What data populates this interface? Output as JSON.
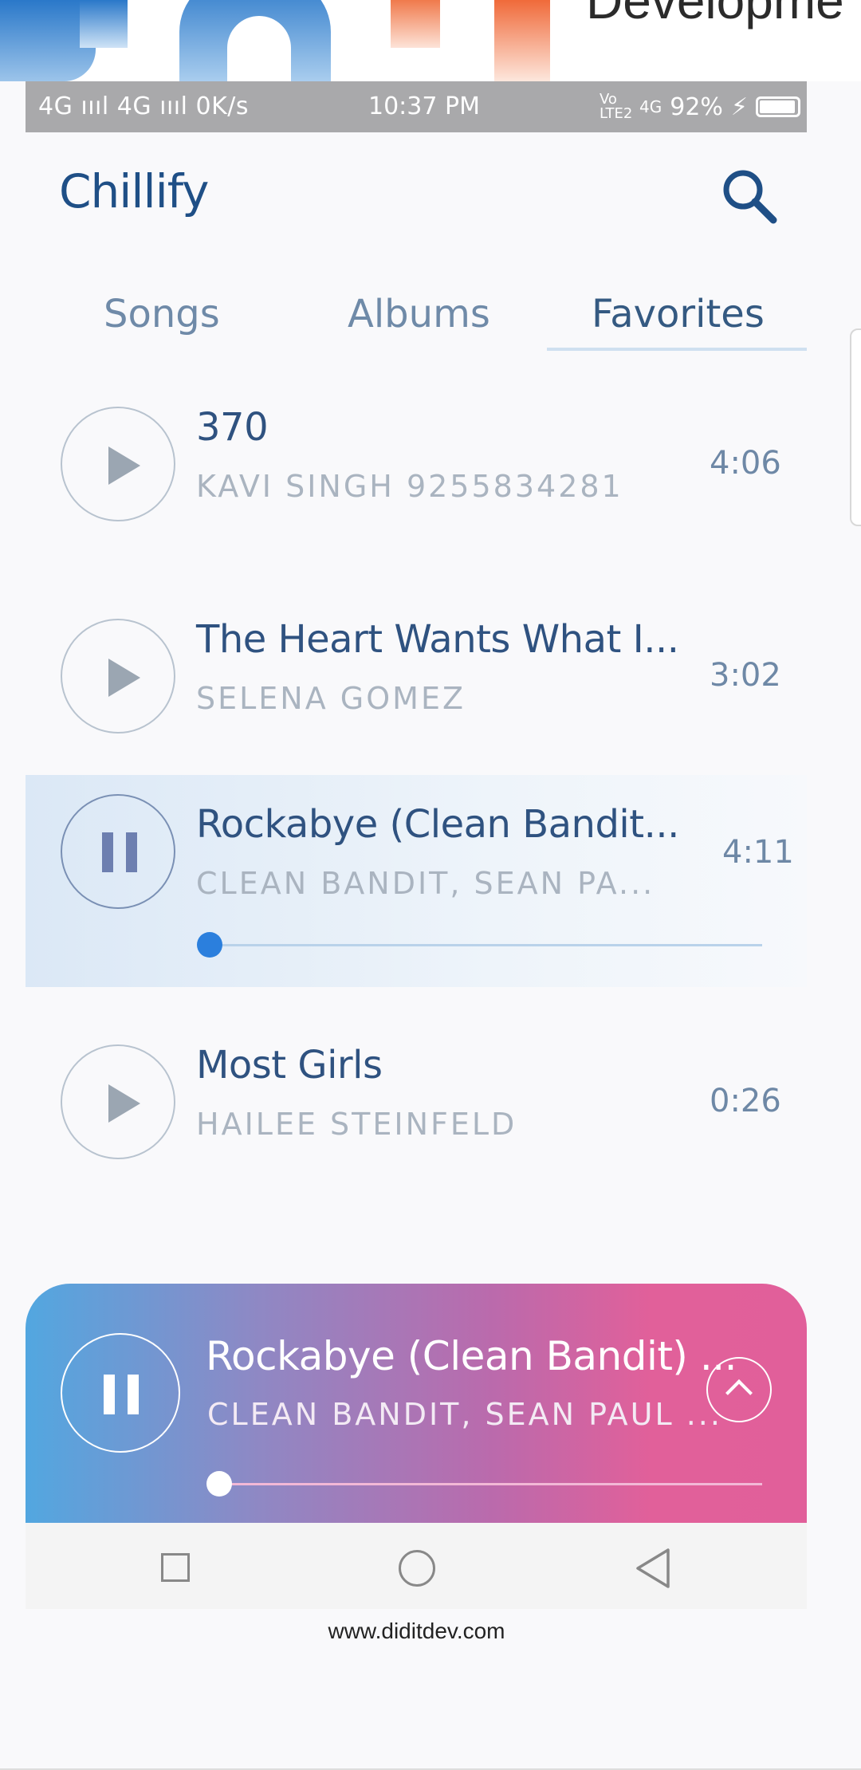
{
  "banner": {
    "cropped_text": "Developme"
  },
  "status_bar": {
    "left": "4G ıııl 4G ıııl 0K/s",
    "time": "10:37 PM",
    "carrier": "Vo LTE2",
    "network": "4G",
    "battery": "92%"
  },
  "app": {
    "title": "Chillify",
    "search_icon": "search-icon"
  },
  "tabs": [
    "Songs",
    "Albums",
    "Favorites"
  ],
  "active_tab": "Favorites",
  "songs": [
    {
      "title": "370",
      "artist": "KAVI SINGH 9255834281",
      "duration": "4:06",
      "state": "paused"
    },
    {
      "title": "The Heart Wants What I...",
      "artist": "SELENA GOMEZ",
      "duration": "3:02",
      "state": "paused"
    },
    {
      "title": "Rockabye (Clean Bandit...",
      "artist": "CLEAN BANDIT, SEAN PA...",
      "duration": "4:11",
      "state": "playing",
      "progress": 0.01
    },
    {
      "title": "Most Girls",
      "artist": "HAILEE STEINFELD",
      "duration": "0:26",
      "state": "paused"
    }
  ],
  "mini_player": {
    "title": "Rockabye (Clean Bandit) ...",
    "artist": "CLEAN BANDIT, SEAN PAUL ...",
    "progress": 0.01
  },
  "colors": {
    "accent": "#2b7fdd",
    "title_text": "#1f4f86",
    "mini_gradient_start": "#52a7e0",
    "mini_gradient_end": "#e15f9a"
  },
  "footer": {
    "url": "www.diditdev.com"
  }
}
